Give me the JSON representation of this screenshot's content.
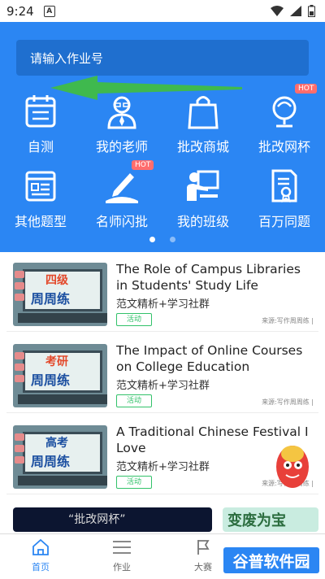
{
  "status_bar": {
    "time": "9:24",
    "notif_letter": "A"
  },
  "search": {
    "placeholder": "请输入作业号"
  },
  "grid": {
    "row1": [
      {
        "label": "自测",
        "icon": "calendar-icon"
      },
      {
        "label": "我的老师",
        "icon": "teacher-icon"
      },
      {
        "label": "批改商城",
        "icon": "shopping-bag-icon"
      },
      {
        "label": "批改网杯",
        "icon": "trophy-icon",
        "badge": "HOT"
      }
    ],
    "row2": [
      {
        "label": "其他题型",
        "icon": "document-list-icon"
      },
      {
        "label": "名师闪批",
        "icon": "pen-paper-icon",
        "badge": "HOT"
      },
      {
        "label": "我的班级",
        "icon": "classroom-icon"
      },
      {
        "label": "百万同题",
        "icon": "certificate-icon"
      }
    ]
  },
  "carousel": {
    "pages": 2,
    "active": 1
  },
  "articles": [
    {
      "thumb_line1": "四级",
      "thumb_line2": "周周练",
      "title": "The Role of Campus Libraries in Students' Study Life",
      "subtitle": "范文精析+学习社群",
      "tag": "活动",
      "source": "来源:写作周周练 |"
    },
    {
      "thumb_line1": "考研",
      "thumb_line2": "周周练",
      "title": "The Impact of Online Courses on College Education",
      "subtitle": "范文精析+学习社群",
      "tag": "活动",
      "source": "来源:写作周周练 |"
    },
    {
      "thumb_line1": "高考",
      "thumb_line2": "周周练",
      "title": "A Traditional Chinese Festival I Love",
      "subtitle": "范文精析+学习社群",
      "tag": "活动",
      "source": "来源:写作周周练 |"
    }
  ],
  "banners": {
    "dark_text": "“批改网杯”",
    "light_text": "变废为宝"
  },
  "tabs": [
    {
      "label": "首页",
      "icon": "home-icon",
      "active": true
    },
    {
      "label": "作业",
      "icon": "menu-lines-icon",
      "active": false
    },
    {
      "label": "大赛",
      "icon": "flag-icon",
      "active": false
    }
  ],
  "watermark": "谷普软件园",
  "colors": {
    "primary": "#2b86f3",
    "search_bg": "#1f6fcf",
    "tag_green": "#32c26a",
    "hot_red": "#ff6d6d"
  }
}
